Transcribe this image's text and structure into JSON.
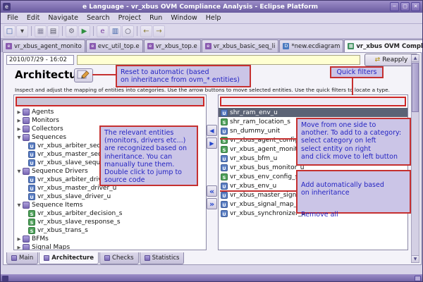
{
  "window": {
    "title": "e Language - vr_xbus OVM Compliance Analysis - Eclipse Platform",
    "icon_glyph": "e",
    "controls": {
      "minimize": "−",
      "maximize": "▢",
      "close": "✕"
    }
  },
  "menu": {
    "items": [
      "File",
      "Edit",
      "Navigate",
      "Search",
      "Project",
      "Run",
      "Window",
      "Help"
    ]
  },
  "toolbar": {
    "icons": [
      {
        "name": "new-wizard-icon",
        "glyph": "□",
        "color": "#3a5fa5"
      },
      {
        "name": "dropdown-arrow-icon",
        "glyph": "▾",
        "color": "#444444"
      },
      {
        "name": "separator"
      },
      {
        "name": "save-icon",
        "glyph": "▦",
        "color": "#8a87a0"
      },
      {
        "name": "print-icon",
        "glyph": "▤",
        "color": "#555566"
      },
      {
        "name": "separator"
      },
      {
        "name": "build-icon",
        "glyph": "⚙",
        "color": "#666677"
      },
      {
        "name": "run-icon",
        "glyph": "▶",
        "color": "#2f8f3f"
      },
      {
        "name": "separator"
      },
      {
        "name": "new-e-file-icon",
        "glyph": "e",
        "color": "#7a3fa0"
      },
      {
        "name": "new-diagram-icon",
        "glyph": "▥",
        "color": "#3a5fa5"
      },
      {
        "name": "search-icon",
        "glyph": "○",
        "color": "#555566"
      },
      {
        "name": "separator"
      },
      {
        "name": "back-icon",
        "glyph": "←",
        "color": "#8a7a30"
      },
      {
        "name": "forward-icon",
        "glyph": "→",
        "color": "#8a7a30"
      }
    ]
  },
  "editor_tabs": {
    "close_glyph": "✕",
    "tabs": [
      {
        "label": "vr_xbus_agent_monito",
        "icon": "e",
        "color": "#8a5ab0",
        "active": false
      },
      {
        "label": "evc_util_top.e",
        "icon": "e",
        "color": "#8a5ab0",
        "active": false
      },
      {
        "label": "vr_xbus_top.e",
        "icon": "e",
        "color": "#8a5ab0",
        "active": false
      },
      {
        "label": "vr_xbus_basic_seq_li",
        "icon": "e",
        "color": "#8a5ab0",
        "active": false
      },
      {
        "label": "*new.ecdiagram",
        "icon": "D",
        "color": "#4a7ac0",
        "active": false
      },
      {
        "label": "vr_xbus OVM Complian",
        "icon": "▦",
        "color": "#3f8f5f",
        "active": true
      }
    ]
  },
  "analysis_bar": {
    "timestamp": "2010/07/29 - 16:02",
    "reapply_label": "Reapply",
    "reapply_icon": "⇄"
  },
  "main": {
    "title": "Architecture",
    "description": "Inspect and adjust the mapping of entities into categories. Use the arrow buttons to move selected entities. Use the quick filters to locate a type.",
    "expander_glyphs": {
      "expanded": "▼",
      "collapsed": "▶"
    },
    "entity_type_glyphs": {
      "u": "U",
      "s": "S"
    },
    "left_tree": {
      "filter_value": "",
      "categories": [
        {
          "label": "Agents",
          "expanded": false,
          "children": []
        },
        {
          "label": "Monitors",
          "expanded": false,
          "children": []
        },
        {
          "label": "Collectors",
          "expanded": false,
          "children": []
        },
        {
          "label": "Sequences",
          "expanded": true,
          "children": [
            "vr_xbus_arbiter_sequence",
            "vr_xbus_master_sequence",
            "vr_xbus_slave_sequence"
          ]
        },
        {
          "label": "Sequence Drivers",
          "expanded": true,
          "children": [
            "vr_xbus_arbiter_driver_u",
            "vr_xbus_master_driver_u",
            "vr_xbus_slave_driver_u"
          ]
        },
        {
          "label": "Sequence Items",
          "expanded": true,
          "children": [
            "vr_xbus_arbiter_decision_s",
            "vr_xbus_slave_response_s",
            "vr_xbus_trans_s"
          ]
        },
        {
          "label": "BFMs",
          "expanded": false,
          "children": []
        },
        {
          "label": "Signal Maps",
          "expanded": false,
          "children": []
        }
      ]
    },
    "right_list": {
      "filter_value": "",
      "selected_index": 0,
      "items": [
        "shr_ram_env_u",
        "shr_ram_location_s",
        "sn_dummy_unit",
        "vr_xbus_agent_config_s",
        "vr_xbus_agent_monitor_config_s",
        "vr_xbus_bfm_u",
        "vr_xbus_bus_monitor_u",
        "vr_xbus_env_config_s",
        "vr_xbus_env_u",
        "vr_xbus_master_signal_map_u",
        "vr_xbus_signal_map_u",
        "vr_xbus_synchronizer_u"
      ]
    },
    "move_buttons": {
      "left": "◀",
      "right": "▶",
      "all_left": "«",
      "all_right": "»"
    }
  },
  "annotations": {
    "reset": "Reset to automatic (based\non inheritance from ovm_* entities)",
    "quick_filters": "Quick filters",
    "relevant": "The relevant entities\n(monitors, drivers etc...)\nare recognized based on\ninheritance. You can\nmanually tune them.\nDouble click to jump to\nsource code",
    "move": "Move from one side to\nanother. To add to a category:\nselect category on left\nselect entity on right\nand click move to left button",
    "add_auto": "Add automatically based\non inheritance",
    "remove_all": "Remove all"
  },
  "bottom_tabs": {
    "tabs": [
      {
        "label": "Main",
        "active": false
      },
      {
        "label": "Architecture",
        "active": true
      },
      {
        "label": "Checks",
        "active": false
      },
      {
        "label": "Statistics",
        "active": false
      }
    ]
  }
}
